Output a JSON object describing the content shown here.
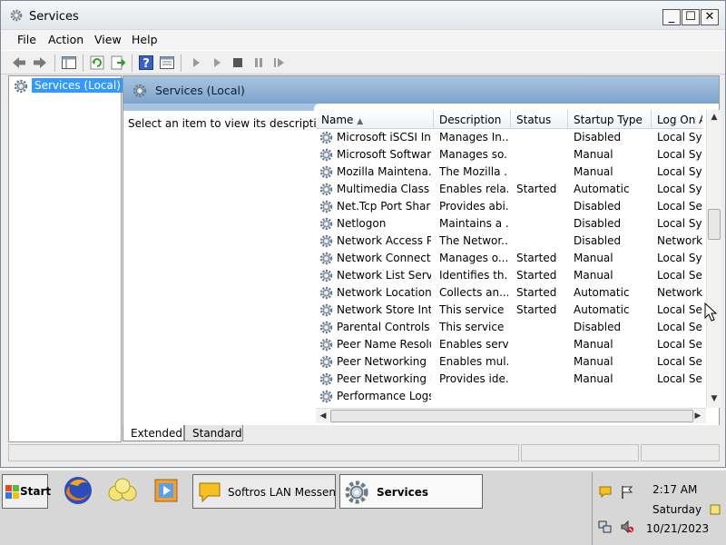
{
  "window": {
    "title": "Services",
    "minimize": "_",
    "maximize": "☐",
    "close": "✕"
  },
  "menu": [
    "File",
    "Action",
    "View",
    "Help"
  ],
  "tree": {
    "selected": "Services (Local)"
  },
  "pane": {
    "title": "Services (Local)",
    "description_hint": "Select an item to view its description."
  },
  "table": {
    "columns": [
      "Name",
      "Description",
      "Status",
      "Startup Type",
      "Log On A"
    ],
    "sort_indicator": "▲",
    "rows": [
      [
        "Microsoft iSCSI Ini...",
        "Manages In...",
        "",
        "Disabled",
        "Local Syst"
      ],
      [
        "Microsoft Softwar...",
        "Manages so...",
        "",
        "Manual",
        "Local Syst"
      ],
      [
        "Mozilla Maintena...",
        "The Mozilla ...",
        "",
        "Manual",
        "Local Syst"
      ],
      [
        "Multimedia Class ...",
        "Enables rela...",
        "Started",
        "Automatic",
        "Local Syst"
      ],
      [
        "Net.Tcp Port Shari...",
        "Provides abi...",
        "",
        "Disabled",
        "Local Serv"
      ],
      [
        "Netlogon",
        "Maintains a ...",
        "",
        "Disabled",
        "Local Syst"
      ],
      [
        "Network Access P...",
        "The Networ...",
        "",
        "Disabled",
        "Network S"
      ],
      [
        "Network Connecti...",
        "Manages o...",
        "Started",
        "Manual",
        "Local Syst"
      ],
      [
        "Network List Service",
        "Identifies th...",
        "Started",
        "Manual",
        "Local Serv"
      ],
      [
        "Network Location ...",
        "Collects an...",
        "Started",
        "Automatic",
        "Network S"
      ],
      [
        "Network Store Int...",
        "This service ...",
        "Started",
        "Automatic",
        "Local Serv"
      ],
      [
        "Parental Controls",
        "This service ...",
        "",
        "Disabled",
        "Local Serv"
      ],
      [
        "Peer Name Resolu...",
        "Enables serv...",
        "",
        "Manual",
        "Local Serv"
      ],
      [
        "Peer Networking ...",
        "Enables mul...",
        "",
        "Manual",
        "Local Serv"
      ],
      [
        "Peer Networking I...",
        "Provides ide...",
        "",
        "Manual",
        "Local Serv"
      ],
      [
        "Performance Logs...",
        "",
        "",
        "",
        ""
      ]
    ]
  },
  "tabs": [
    "Extended",
    "Standard"
  ],
  "taskbar": {
    "start": "Start",
    "buttons": [
      {
        "label": "Softros LAN Messen...",
        "icon": "messenger-icon"
      },
      {
        "label": "Services",
        "icon": "services-gear-icon"
      }
    ],
    "clock": {
      "time": "2:17 AM",
      "day": "Saturday",
      "date": "10/21/2023"
    }
  },
  "icons": [
    "back-arrow-icon",
    "forward-arrow-icon",
    "show-hide-tree-icon",
    "refresh-icon",
    "export-icon",
    "help-icon",
    "properties-icon",
    "play-icon",
    "resume-icon",
    "stop-icon",
    "pause-icon",
    "restart-icon",
    "firefox-icon",
    "folder-icon",
    "media-player-icon"
  ],
  "colors": {
    "selection": "#3399ff",
    "pane_header": "#a8c4e0"
  }
}
